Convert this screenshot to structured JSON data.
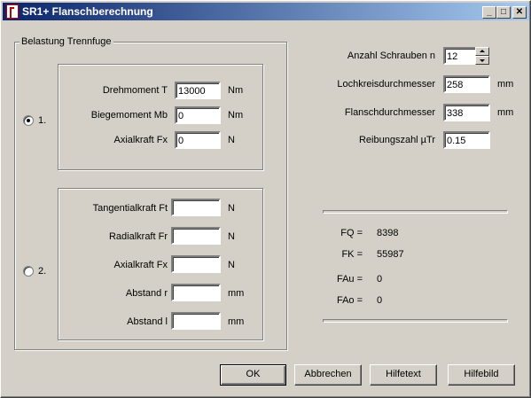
{
  "window": {
    "title": "SR1+ Flanschberechnung",
    "minimize": "_",
    "maximize": "□",
    "close": "✕"
  },
  "group": {
    "title": "Belastung Trennfuge"
  },
  "option1": {
    "radio_label": "1.",
    "fields": [
      {
        "label": "Drehmoment T",
        "value": "13000",
        "unit": "Nm"
      },
      {
        "label": "Biegemoment Mb",
        "value": "0",
        "unit": "Nm"
      },
      {
        "label": "Axialkraft Fx",
        "value": "0",
        "unit": "N"
      }
    ]
  },
  "option2": {
    "radio_label": "2.",
    "fields": [
      {
        "label": "Tangentialkraft Ft",
        "value": "",
        "unit": "N"
      },
      {
        "label": "Radialkraft Fr",
        "value": "",
        "unit": "N"
      },
      {
        "label": "Axialkraft Fx",
        "value": "",
        "unit": "N"
      },
      {
        "label": "Abstand r",
        "value": "",
        "unit": "mm"
      },
      {
        "label": "Abstand l",
        "value": "",
        "unit": "mm"
      }
    ]
  },
  "right": {
    "screws": {
      "label": "Anzahl Schrauben n",
      "value": "12"
    },
    "bolt_circle": {
      "label": "Lochkreisdurchmesser",
      "value": "258",
      "unit": "mm"
    },
    "flange_dia": {
      "label": "Flanschdurchmesser",
      "value": "338",
      "unit": "mm"
    },
    "friction": {
      "label": "Reibungszahl µTr",
      "value": "0.15"
    }
  },
  "results": [
    {
      "label": "FQ =",
      "value": "8398"
    },
    {
      "label": "FK =",
      "value": "55987"
    },
    {
      "label": "FAu =",
      "value": "0"
    },
    {
      "label": "FAo =",
      "value": "0"
    }
  ],
  "buttons": {
    "ok": "OK",
    "cancel": "Abbrechen",
    "helptext": "Hilfetext",
    "helpimage": "Hilfebild"
  }
}
